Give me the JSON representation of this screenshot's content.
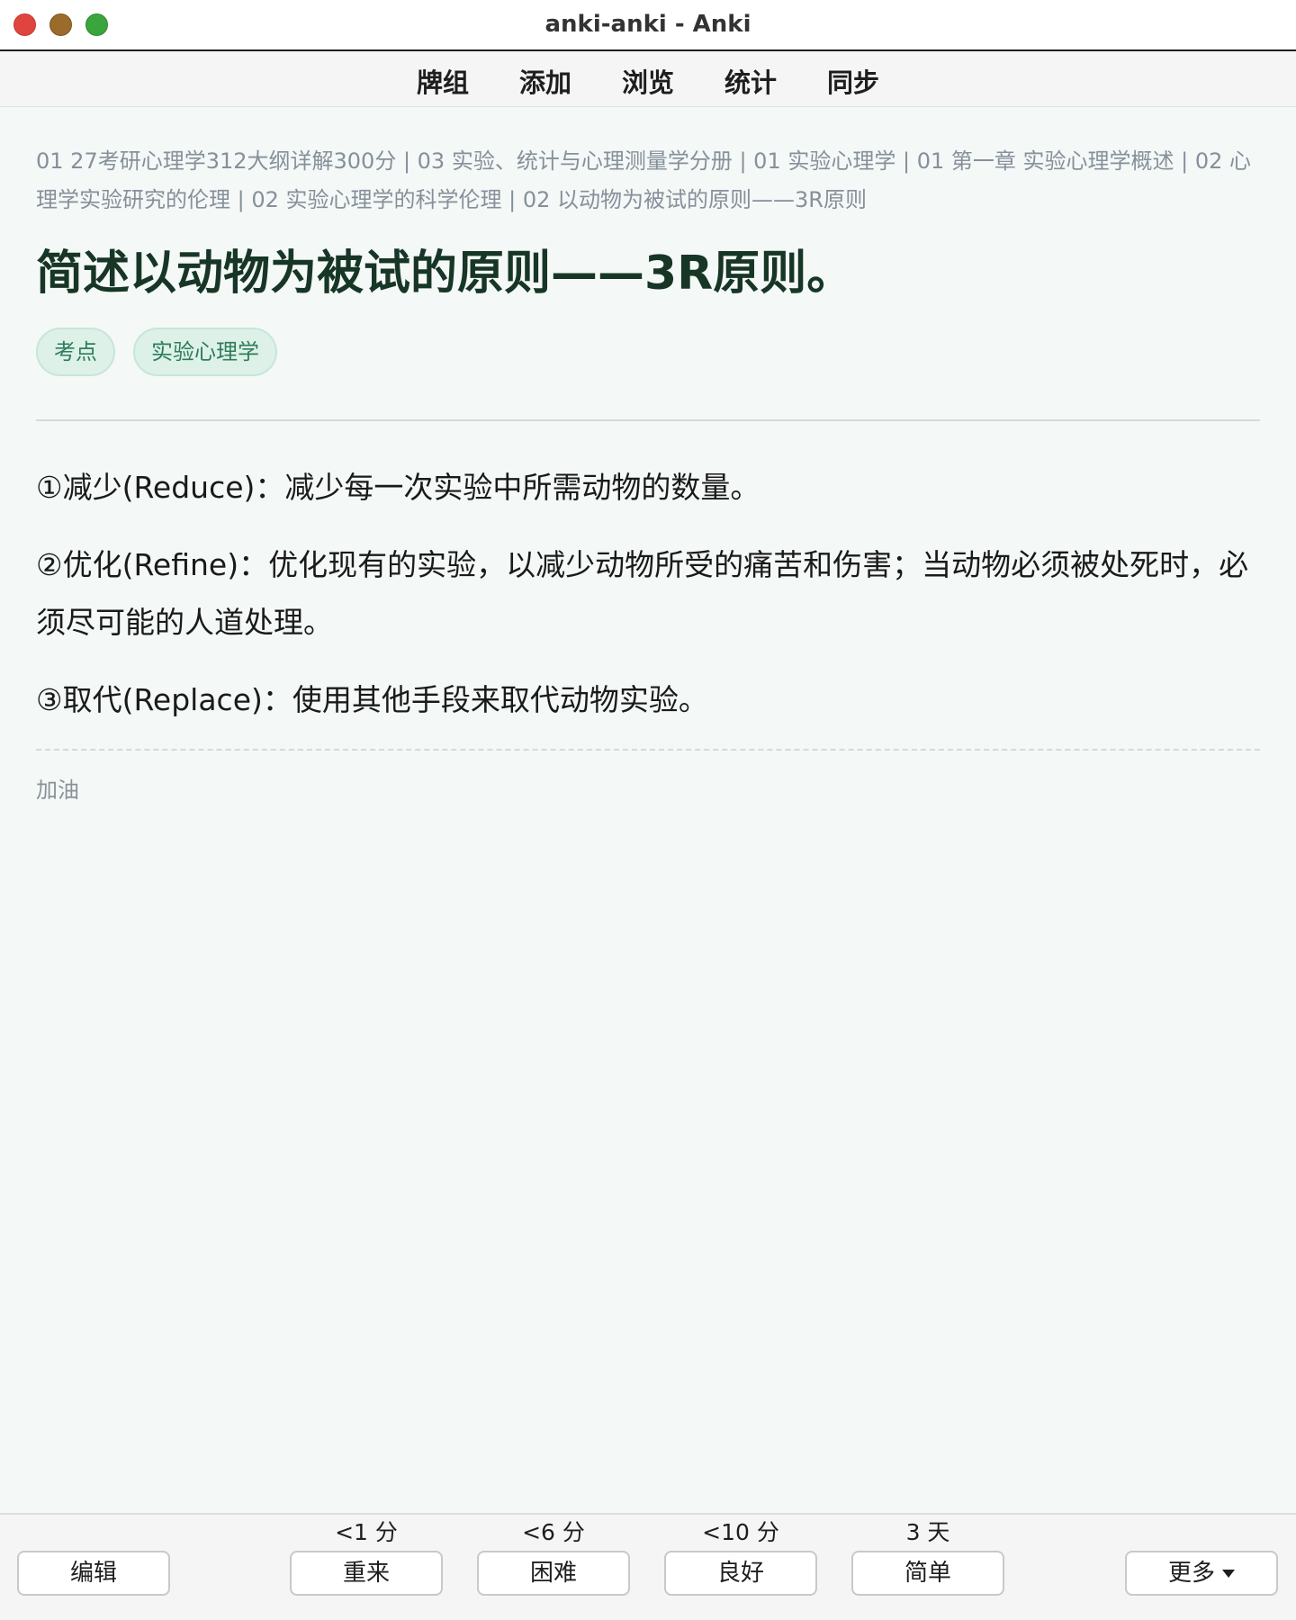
{
  "window": {
    "title": "anki-anki - Anki"
  },
  "toolbar": {
    "items": [
      "牌组",
      "添加",
      "浏览",
      "统计",
      "同步"
    ]
  },
  "card": {
    "breadcrumb": "01 27考研心理学312大纲详解300分 | 03 实验、统计与心理测量学分册 | 01 实验心理学 | 01 第一章 实验心理学概述 | 02 心理学实验研究的伦理 | 02 实验心理学的科学伦理 | 02 以动物为被试的原则——3R原则",
    "title": "简述以动物为被试的原则——3R原则。",
    "tags": [
      "考点",
      "实验心理学"
    ],
    "answer": [
      "①减少(Reduce)：减少每一次实验中所需动物的数量。",
      "②优化(Refine)：优化现有的实验，以减少动物所受的痛苦和伤害；当动物必须被处死时，必须尽可能的人道处理。",
      "③取代(Replace)：使用其他手段来取代动物实验。"
    ],
    "note": "加油"
  },
  "bottombar": {
    "edit_label": "编辑",
    "more_label": "更多",
    "ease_buttons": [
      {
        "label": "重来",
        "interval": "<1 分"
      },
      {
        "label": "困难",
        "interval": "<6 分"
      },
      {
        "label": "良好",
        "interval": "<10 分"
      },
      {
        "label": "简单",
        "interval": "3 天"
      }
    ]
  },
  "colors": {
    "background": "#f4f8f7",
    "title": "#173626",
    "tag_bg": "#ddf1e8",
    "tag_text": "#2e7d5a",
    "breadcrumb": "#86909a"
  }
}
